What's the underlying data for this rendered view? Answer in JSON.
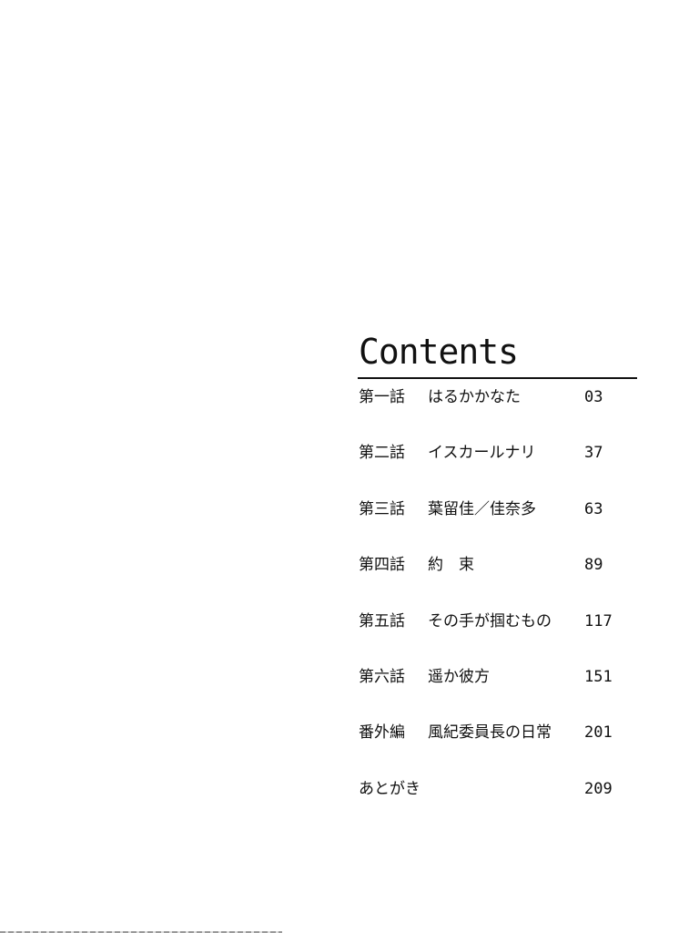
{
  "toc": {
    "title": "Contents",
    "entries": [
      {
        "chapter": "第一話",
        "subtitle": "はるかかなた",
        "page": "03"
      },
      {
        "chapter": "第二話",
        "subtitle": "イスカールナリ",
        "page": "37"
      },
      {
        "chapter": "第三話",
        "subtitle": "葉留佳／佳奈多",
        "page": "63"
      },
      {
        "chapter": "第四話",
        "subtitle": "約　束",
        "page": "89"
      },
      {
        "chapter": "第五話",
        "subtitle": "その手が掴むもの",
        "page": "117"
      },
      {
        "chapter": "第六話",
        "subtitle": "遥か彼方",
        "page": "151"
      },
      {
        "chapter": "番外編",
        "subtitle": "風紀委員長の日常",
        "page": "201"
      },
      {
        "chapter": "あとがき",
        "subtitle": "",
        "page": "209"
      }
    ]
  }
}
